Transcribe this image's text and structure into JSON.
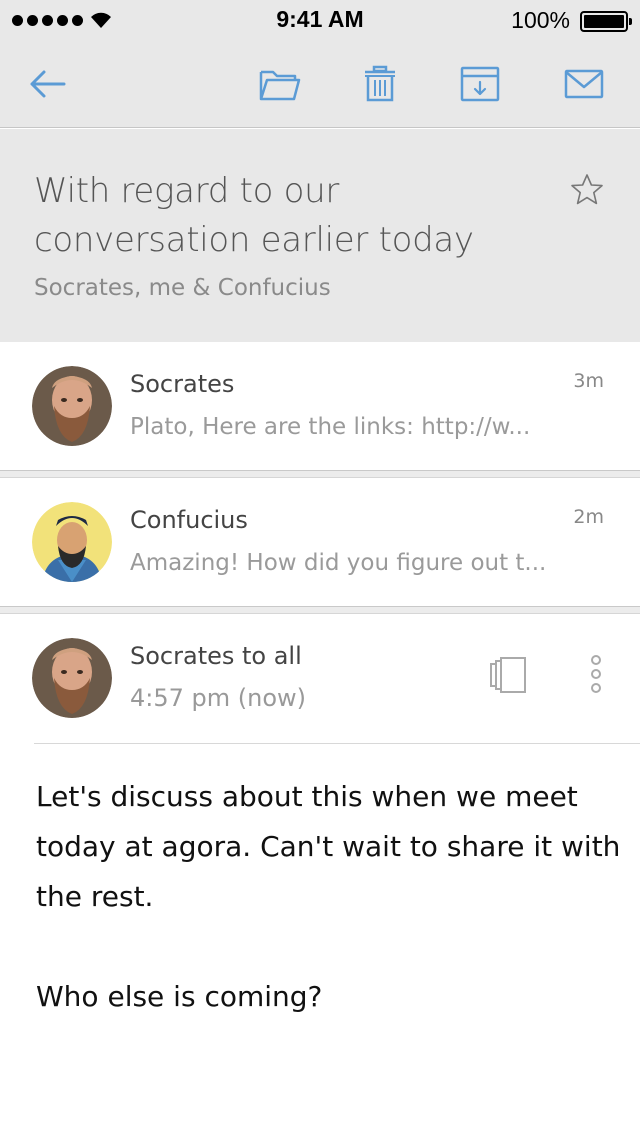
{
  "status_bar": {
    "time": "9:41 AM",
    "battery": "100%",
    "signal_icon": "signal-dots-icon",
    "wifi_icon": "wifi-icon"
  },
  "toolbar": {
    "back_icon": "back-arrow-icon",
    "actions": [
      {
        "icon": "folder-icon"
      },
      {
        "icon": "trash-icon"
      },
      {
        "icon": "archive-icon"
      },
      {
        "icon": "mail-icon"
      }
    ],
    "accent_color": "#5b9bd5"
  },
  "thread": {
    "subject": "With regard to our conversation earlier today",
    "participants": "Socrates, me & Confucius",
    "star_icon": "star-icon"
  },
  "messages": [
    {
      "sender": "Socrates",
      "snippet": "Plato, Here are the links: http://w...",
      "time": "3m"
    },
    {
      "sender": "Confucius",
      "snippet": "Amazing! How did you figure out t...",
      "time": "2m"
    }
  ],
  "expanded_message": {
    "sender": "Socrates to all",
    "time": "4:57 pm (now)",
    "body": [
      "Let's discuss about this when we meet today at agora. Can't wait to share it with the rest.",
      "Who else is coming?"
    ],
    "actions": [
      {
        "icon": "stacked-pages-icon"
      },
      {
        "icon": "more-vertical-icon"
      }
    ]
  }
}
